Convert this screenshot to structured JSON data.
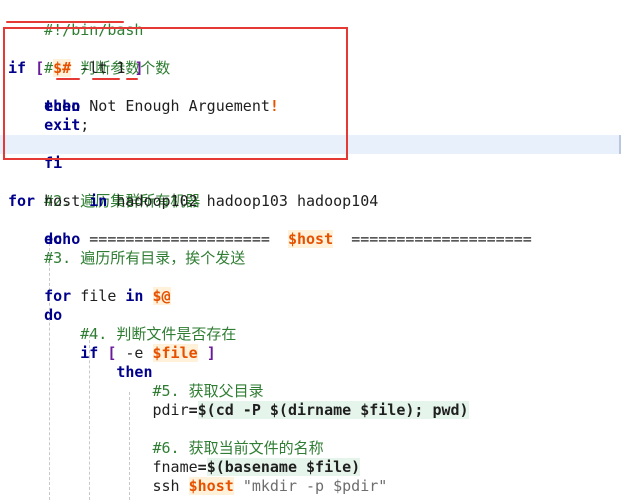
{
  "editor": {
    "lines": {
      "shebang": "#!/bin/bash",
      "c1": "#1. 判断参数个数",
      "if_kw": "if",
      "if_open": "[",
      "if_var": "$#",
      "if_op": "-lt",
      "if_num": "1",
      "if_close": "]",
      "then_kw": "then",
      "echo_kw": "echo",
      "echo_text": "Not Enough Arguement",
      "bang": "!",
      "exit_kw": "exit",
      "semi": ";",
      "fi_kw": "fi",
      "c2": "#2. 遍历集群所有机器",
      "for_kw": "for",
      "host_word": "host",
      "in_kw": "in",
      "hosts": "hadoop102 hadoop103 hadoop104",
      "do_kw": "do",
      "echo2_kw": "echo",
      "eq_left": "====================",
      "host_var": "$host",
      "eq_right": "====================",
      "c3": "#3. 遍历所有目录，挨个发送",
      "for2_kw": "for",
      "file_word": "file",
      "in2_kw": "in",
      "at_var": "$@",
      "do2_kw": "do",
      "c4": "#4. 判断文件是否存在",
      "if2_kw": "if",
      "if2_open": "[",
      "if2_op": "-e",
      "file_var": "$file",
      "if2_close": "]",
      "then2_kw": "then",
      "c5": "#5. 获取父目录",
      "pdir_name": "pdir",
      "pdir_eq": "=",
      "pdir_expr": "$(cd -P $(dirname $file); pwd)",
      "c6": "#6. 获取当前文件的名称",
      "fname_name": "fname",
      "fname_eq": "=",
      "fname_expr": "$(basename $file)",
      "ssh_cmd": "ssh",
      "ssh_host": "$host",
      "ssh_str": "\"mkdir -p $pdir\""
    }
  }
}
